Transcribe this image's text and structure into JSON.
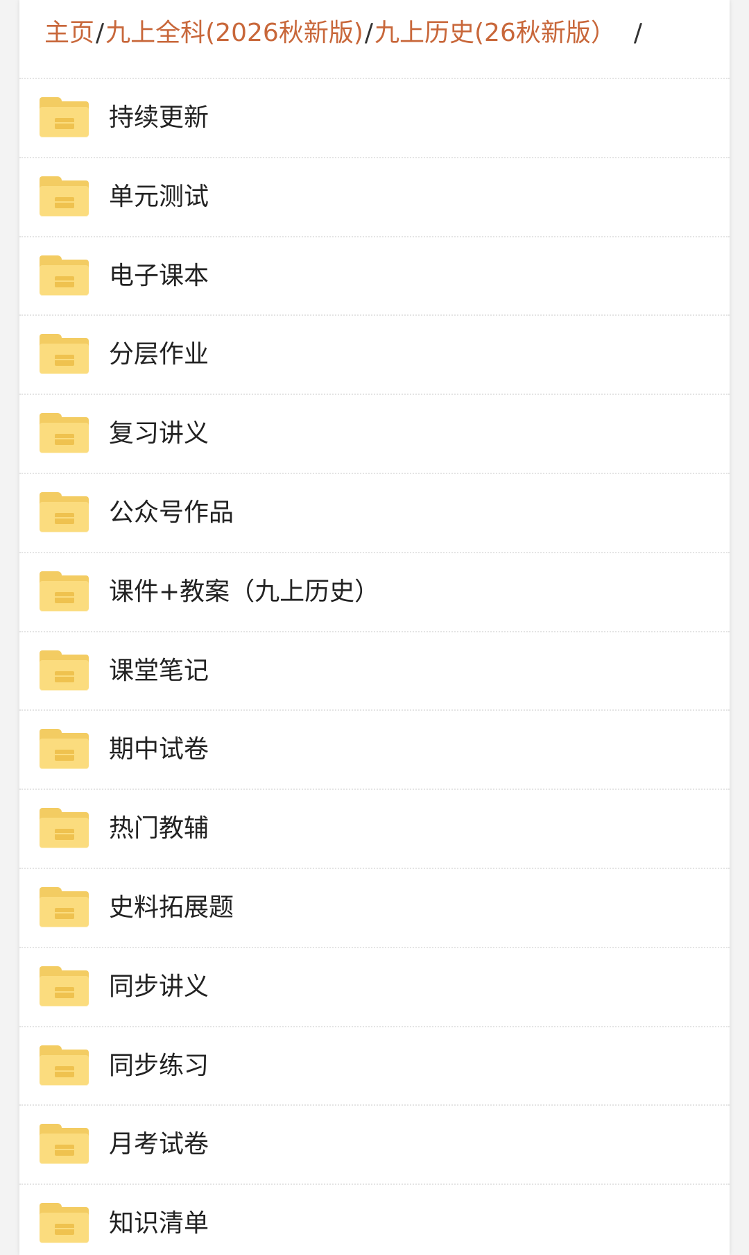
{
  "breadcrumb": {
    "home": "主页",
    "level1": "九上全科(2026秋新版)",
    "level2": "九上历史(26秋新版）",
    "separator": "/"
  },
  "folders": [
    {
      "label": "持续更新"
    },
    {
      "label": "单元测试"
    },
    {
      "label": "电子课本"
    },
    {
      "label": "分层作业"
    },
    {
      "label": "复习讲义"
    },
    {
      "label": "公众号作品"
    },
    {
      "label": "课件+教案（九上历史）"
    },
    {
      "label": "课堂笔记"
    },
    {
      "label": "期中试卷"
    },
    {
      "label": "热门教辅"
    },
    {
      "label": "史料拓展题"
    },
    {
      "label": "同步讲义"
    },
    {
      "label": "同步练习"
    },
    {
      "label": "月考试卷"
    },
    {
      "label": "知识清单"
    }
  ],
  "colors": {
    "link": "#c8673a",
    "folder": "#fbdc7e",
    "text": "#222222"
  }
}
